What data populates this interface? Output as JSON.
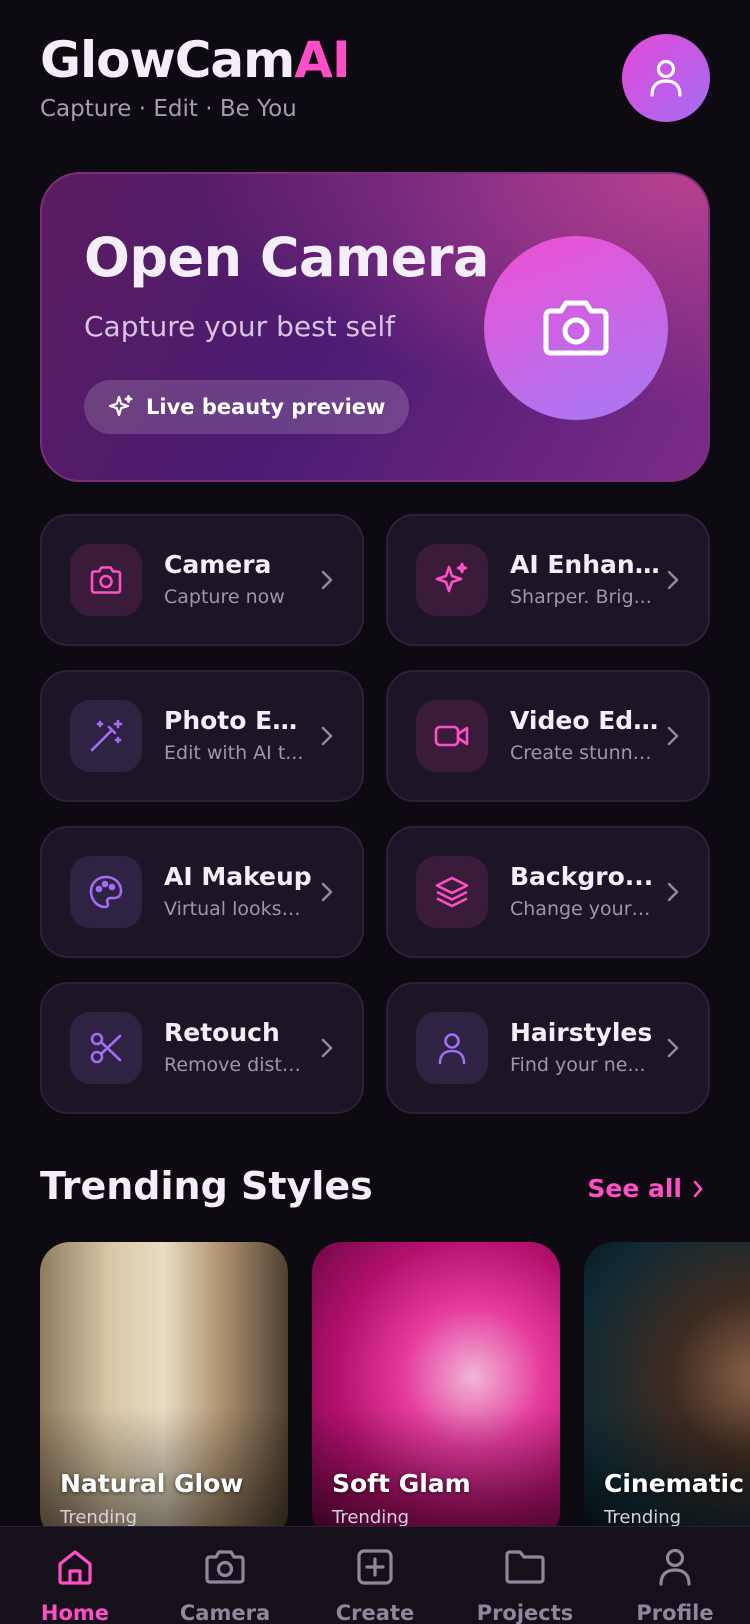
{
  "header": {
    "title_main": "GlowCam",
    "title_accent": "AI",
    "tagline": "Capture · Edit · Be You",
    "avatar_icon": "user-icon"
  },
  "hero": {
    "title": "Open Camera",
    "subtitle": "Capture your best self",
    "chip_label": "Live beauty preview",
    "chip_icon": "sparkle-icon",
    "button_icon": "camera-icon"
  },
  "features": [
    {
      "title": "Camera",
      "subtitle": "Capture now",
      "icon": "camera-icon",
      "tone": "pink"
    },
    {
      "title": "AI Enhan...",
      "subtitle": "Sharper. Brig...",
      "icon": "sparkle-icon",
      "tone": "pink"
    },
    {
      "title": "Photo Ed...",
      "subtitle": "Edit with AI t...",
      "icon": "magic-wand-icon",
      "tone": "purple"
    },
    {
      "title": "Video Edi...",
      "subtitle": "Create stunni...",
      "icon": "video-icon",
      "tone": "pink"
    },
    {
      "title": "AI Makeup",
      "subtitle": "Virtual looks, ...",
      "icon": "palette-icon",
      "tone": "purple"
    },
    {
      "title": "Backgro...",
      "subtitle": "Change your ...",
      "icon": "layers-icon",
      "tone": "pink"
    },
    {
      "title": "Retouch",
      "subtitle": "Remove distr...",
      "icon": "scissors-icon",
      "tone": "purple"
    },
    {
      "title": "Hairstyles",
      "subtitle": "Find your ne...",
      "icon": "user-icon",
      "tone": "purple"
    }
  ],
  "trending": {
    "title": "Trending Styles",
    "see_all": "See all",
    "items": [
      {
        "label": "Natural Glow",
        "sub": "Trending"
      },
      {
        "label": "Soft Glam",
        "sub": "Trending"
      },
      {
        "label": "Cinematic",
        "sub": "Trending"
      }
    ]
  },
  "nav": {
    "items": [
      {
        "label": "Home",
        "icon": "home-icon",
        "active": true
      },
      {
        "label": "Camera",
        "icon": "camera-icon",
        "active": false
      },
      {
        "label": "Create",
        "icon": "plus-square-icon",
        "active": false
      },
      {
        "label": "Projects",
        "icon": "folder-icon",
        "active": false
      },
      {
        "label": "Profile",
        "icon": "user-icon",
        "active": false
      }
    ]
  },
  "colors": {
    "accent_pink": "#ff4fc6",
    "accent_purple": "#a56cf5",
    "background": "#0d0a12",
    "card": "#1c1526"
  }
}
